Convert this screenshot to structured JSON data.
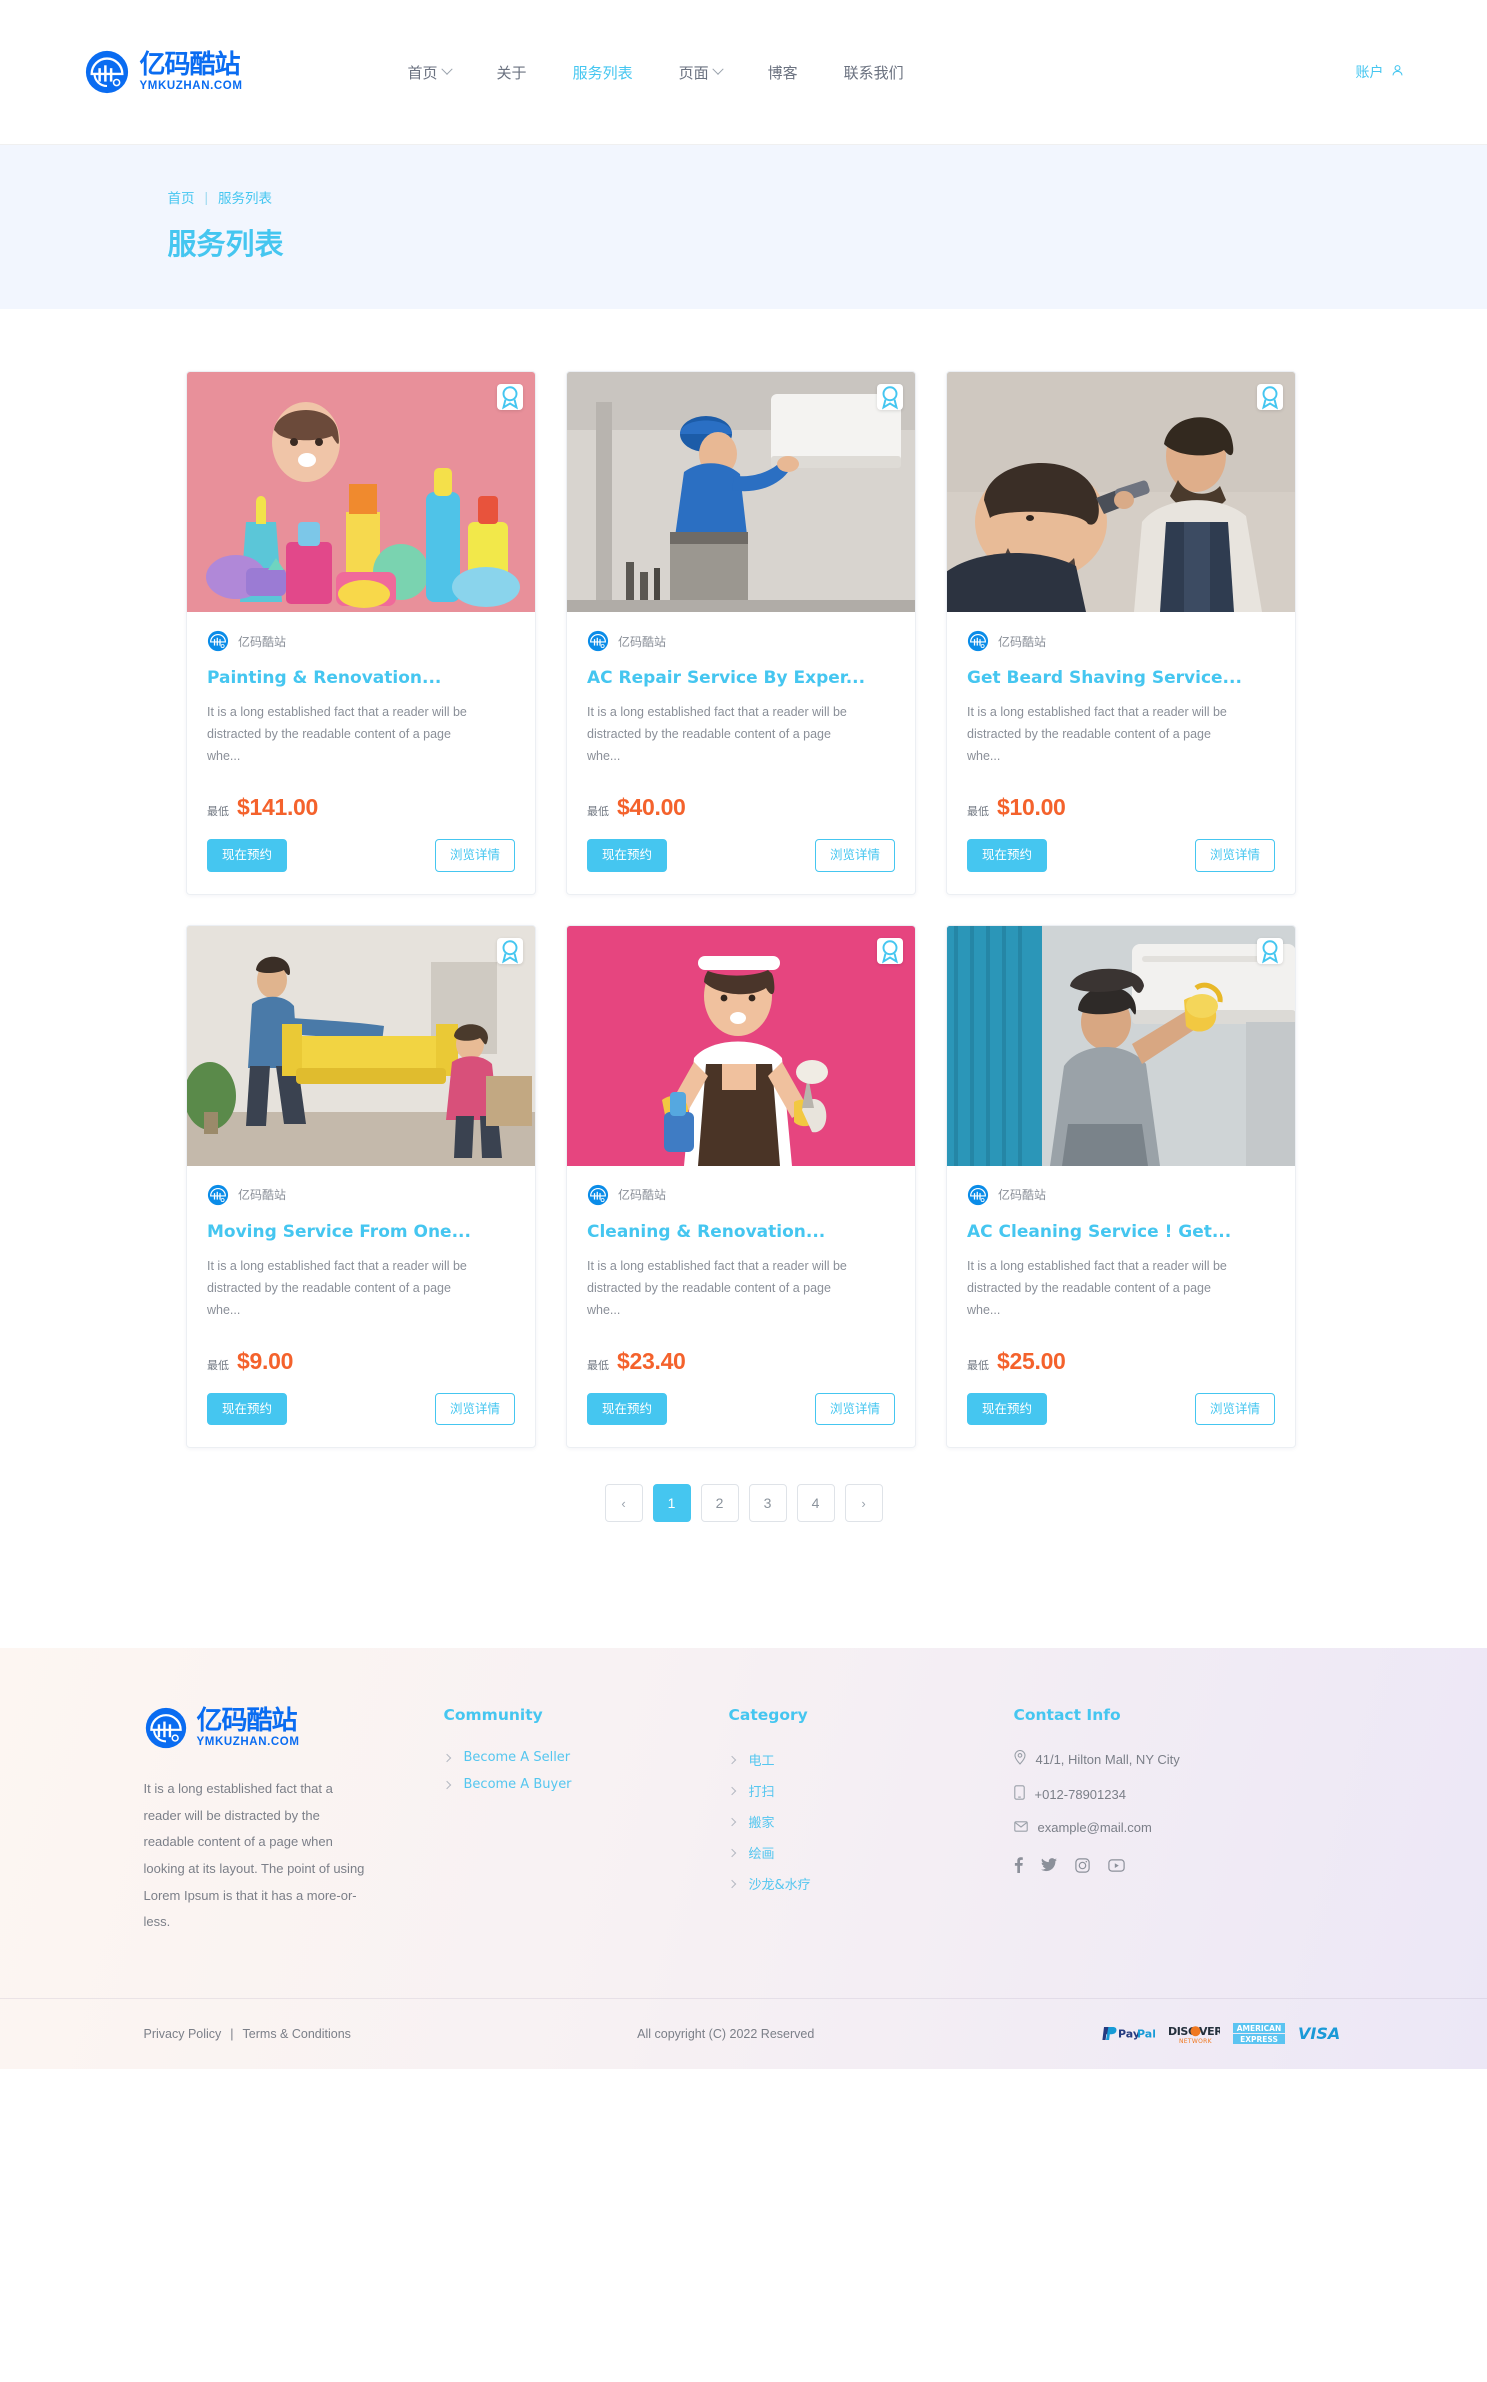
{
  "header": {
    "brand": {
      "cn": "亿码酷站",
      "en": "YMKUZHAN.COM",
      "logo_icon": "ymkuzhan-circle-logo"
    },
    "nav": [
      {
        "label": "首页",
        "has_caret": true,
        "active": false
      },
      {
        "label": "关于",
        "has_caret": false,
        "active": false
      },
      {
        "label": "服务列表",
        "has_caret": false,
        "active": true
      },
      {
        "label": "页面",
        "has_caret": true,
        "active": false
      },
      {
        "label": "博客",
        "has_caret": false,
        "active": false
      },
      {
        "label": "联系我们",
        "has_caret": false,
        "active": false
      }
    ],
    "account": {
      "label": "账户",
      "icon": "user-icon"
    }
  },
  "banner": {
    "crumb_home": "首页",
    "crumb_sep": "|",
    "crumb_current": "服务列表",
    "title": "服务列表"
  },
  "cards": [
    {
      "seller": "亿码酷站",
      "title": "Painting & Renovation...",
      "desc": "It is a long established fact that a reader will be distracted by the readable content of a page whe...",
      "price_label": "最低",
      "price": "$141.00",
      "book_label": "现在预约",
      "detail_label": "浏览详情",
      "fav_icon": "award-badge-icon",
      "image": "cleaning-supplies-woman"
    },
    {
      "seller": "亿码酷站",
      "title": "AC Repair Service By Exper...",
      "desc": "It is a long established fact that a reader will be distracted by the readable content of a page whe...",
      "price_label": "最低",
      "price": "$40.00",
      "book_label": "现在预约",
      "detail_label": "浏览详情",
      "fav_icon": "award-badge-icon",
      "image": "ac-repair-technician"
    },
    {
      "seller": "亿码酷站",
      "title": "Get Beard Shaving Service...",
      "desc": "It is a long established fact that a reader will be distracted by the readable content of a page whe...",
      "price_label": "最低",
      "price": "$10.00",
      "book_label": "现在预约",
      "detail_label": "浏览详情",
      "fav_icon": "award-badge-icon",
      "image": "barber-beard-shaving"
    },
    {
      "seller": "亿码酷站",
      "title": "Moving Service From One...",
      "desc": "It is a long established fact that a reader will be distracted by the readable content of a page whe...",
      "price_label": "最低",
      "price": "$9.00",
      "book_label": "现在预约",
      "detail_label": "浏览详情",
      "fav_icon": "award-badge-icon",
      "image": "movers-yellow-sofa"
    },
    {
      "seller": "亿码酷站",
      "title": "Cleaning & Renovation...",
      "desc": "It is a long established fact that a reader will be distracted by the readable content of a page whe...",
      "price_label": "最低",
      "price": "$23.40",
      "book_label": "现在预约",
      "detail_label": "浏览详情",
      "fav_icon": "award-badge-icon",
      "image": "cleaning-lady-pink"
    },
    {
      "seller": "亿码酷站",
      "title": "AC Cleaning Service ! Get...",
      "desc": "It is a long established fact that a reader will be distracted by the readable content of a page whe...",
      "price_label": "最低",
      "price": "$25.00",
      "book_label": "现在预约",
      "detail_label": "浏览详情",
      "fav_icon": "award-badge-icon",
      "image": "ac-cleaning-woman"
    }
  ],
  "pagination": {
    "prev": "‹",
    "next": "›",
    "pages": [
      "1",
      "2",
      "3",
      "4"
    ],
    "active_index": 0
  },
  "footer": {
    "brand": {
      "cn": "亿码酷站",
      "en": "YMKUZHAN.COM"
    },
    "about": "It is a long established fact that a reader will be distracted by the readable content of a page when looking at its layout. The point of using Lorem Ipsum is that it has a more-or-less.",
    "community": {
      "heading": "Community",
      "links": [
        "Become A Seller",
        "Become A Buyer"
      ]
    },
    "category": {
      "heading": "Category",
      "links": [
        "电工",
        "打扫",
        "搬家",
        "绘画",
        "沙龙&水疗"
      ]
    },
    "contact": {
      "heading": "Contact Info",
      "address": "41/1, Hilton Mall, NY City",
      "phone": "+012-78901234",
      "email": "example@mail.com",
      "socials": [
        "facebook-icon",
        "twitter-icon",
        "instagram-icon",
        "youtube-icon"
      ]
    },
    "bottom": {
      "privacy": "Privacy Policy",
      "sep": "|",
      "terms": "Terms & Conditions",
      "copyright": "All copyright (C) 2022 Reserved",
      "payments": [
        "paypal-logo",
        "discover-logo",
        "amex-logo",
        "visa-logo"
      ]
    }
  },
  "colors": {
    "accent": "#45c6f0",
    "brand_blue": "#0a6cf1",
    "price_orange": "#f4622c",
    "banner_bg": "#f2f6fe"
  }
}
